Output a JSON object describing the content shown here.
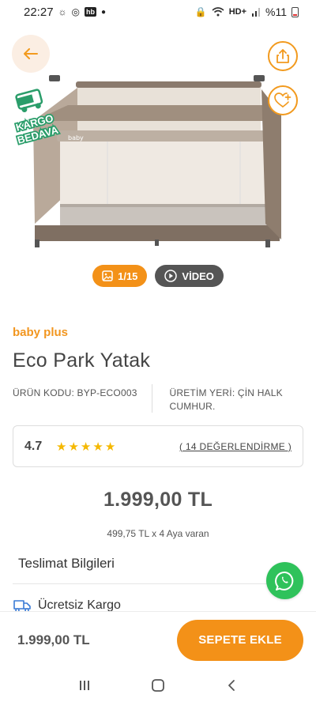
{
  "status_bar": {
    "time": "22:27",
    "network": "HD+",
    "battery": "%11",
    "app_badge": "hb"
  },
  "hero": {
    "icons": {
      "back": "arrow-left-icon",
      "share": "share-icon",
      "favorite": "heart-plus-icon"
    },
    "badge": {
      "line1": "KARGO",
      "line2": "BEDAVA"
    },
    "media": {
      "image_count": "1/15",
      "video_label": "VİDEO"
    }
  },
  "product": {
    "brand": "baby plus",
    "title": "Eco Park Yatak",
    "code": "ÜRÜN KODU: BYP-ECO003",
    "origin": "ÜRETİM YERİ: ÇİN HALK CUMHUR.",
    "rating": "4.7",
    "stars": 5,
    "reviews_link": "( 14 DEĞERLENDİRME )",
    "price": "1.999,00 TL",
    "installment": "499,75 TL x 4 Aya varan"
  },
  "delivery": {
    "section_title": "Teslimat Bilgileri",
    "shipping_label": "Ücretsiz Kargo"
  },
  "bottom_bar": {
    "price": "1.999,00 TL",
    "cart_button": "SEPETE EKLE"
  },
  "colors": {
    "accent": "#f39118",
    "whatsapp": "#2fc25b",
    "star": "#f5b800",
    "cargo_badge": "#2a9d6a"
  }
}
